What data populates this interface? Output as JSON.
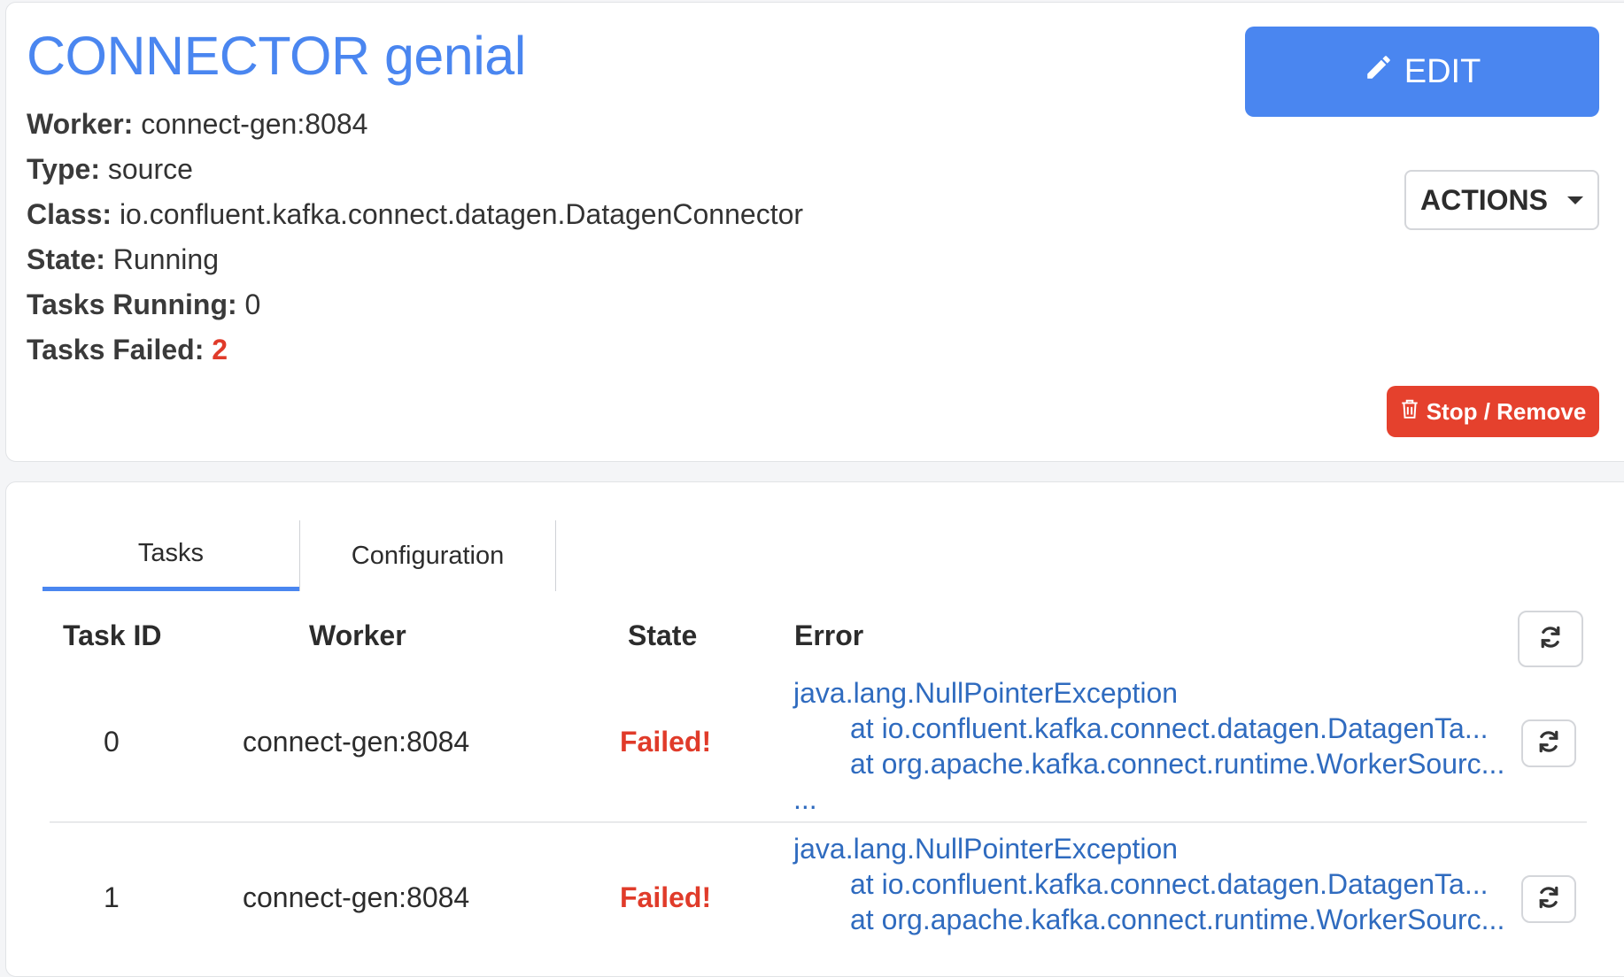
{
  "connector": {
    "title": "CONNECTOR genial",
    "fields": [
      {
        "key": "Worker:",
        "value": "connect-gen:8084"
      },
      {
        "key": "Type:",
        "value": "source"
      },
      {
        "key": "Class:",
        "value": "io.confluent.kafka.connect.datagen.DatagenConnector"
      },
      {
        "key": "State:",
        "value": "Running"
      },
      {
        "key": "Tasks Running:",
        "value": "0"
      },
      {
        "key": "Tasks Failed:",
        "value": "2"
      }
    ]
  },
  "buttons": {
    "edit_label": "EDIT",
    "actions_label": "ACTIONS",
    "stop_label": "Stop / Remove"
  },
  "tabs": [
    {
      "label": "Tasks",
      "active": true
    },
    {
      "label": "Configuration",
      "active": false
    }
  ],
  "table": {
    "headers": [
      "Task ID",
      "Worker",
      "State",
      "Error"
    ],
    "rows": [
      {
        "task_id": "0",
        "worker": "connect-gen:8084",
        "state": "Failed!",
        "error_lines": [
          "java.lang.NullPointerException",
          "at io.confluent.kafka.connect.datagen.DatagenTa...",
          "at org.apache.kafka.connect.runtime.WorkerSourc...",
          "..."
        ]
      },
      {
        "task_id": "1",
        "worker": "connect-gen:8084",
        "state": "Failed!",
        "error_lines": [
          "java.lang.NullPointerException",
          "at io.confluent.kafka.connect.datagen.DatagenTa...",
          "at org.apache.kafka.connect.runtime.WorkerSourc..."
        ]
      }
    ]
  },
  "colors": {
    "accent": "#4a86f0",
    "danger": "#e5412d",
    "link": "#2f6bbf"
  },
  "icons": {
    "edit": "pencil-icon",
    "actions": "chevron-down-icon",
    "stop": "trash-icon",
    "refresh": "refresh-icon"
  }
}
